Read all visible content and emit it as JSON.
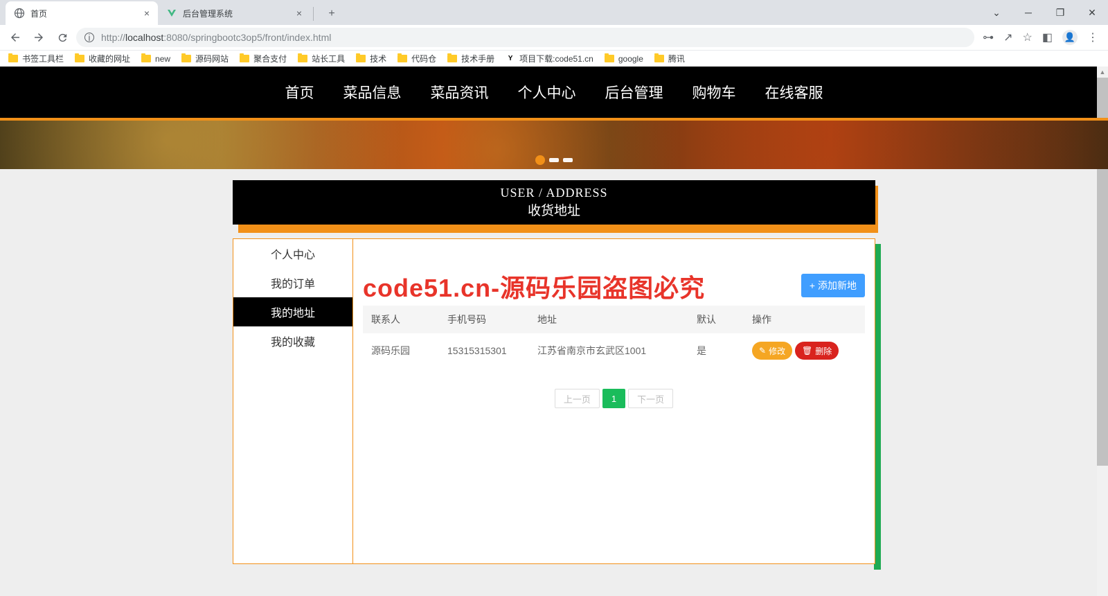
{
  "browser": {
    "tabs": [
      {
        "title": "首页",
        "favicon": "globe",
        "active": true
      },
      {
        "title": "后台管理系统",
        "favicon": "vue",
        "active": false
      }
    ],
    "url_prefix": "http://",
    "url_host": "localhost",
    "url_rest": ":8080/springbootc3op5/front/index.html",
    "bookmarks": [
      {
        "label": "书签工具栏",
        "icon": "folder"
      },
      {
        "label": "收藏的网址",
        "icon": "folder"
      },
      {
        "label": "new",
        "icon": "folder"
      },
      {
        "label": "源码网站",
        "icon": "folder"
      },
      {
        "label": "聚合支付",
        "icon": "folder"
      },
      {
        "label": "站长工具",
        "icon": "folder"
      },
      {
        "label": "技术",
        "icon": "folder"
      },
      {
        "label": "代码仓",
        "icon": "folder"
      },
      {
        "label": "技术手册",
        "icon": "folder"
      },
      {
        "label": "项目下载:code51.cn",
        "icon": "y"
      },
      {
        "label": "google",
        "icon": "folder"
      },
      {
        "label": "腾讯",
        "icon": "folder"
      }
    ]
  },
  "nav": {
    "items": [
      "首页",
      "菜品信息",
      "菜品资讯",
      "个人中心",
      "后台管理",
      "购物车",
      "在线客服"
    ]
  },
  "title": {
    "en": "USER / ADDRESS",
    "zh": "收货地址"
  },
  "sidebar": {
    "items": [
      {
        "label": "个人中心",
        "active": false
      },
      {
        "label": "我的订单",
        "active": false
      },
      {
        "label": "我的地址",
        "active": true
      },
      {
        "label": "我的收藏",
        "active": false
      }
    ]
  },
  "watermark": "code51.cn-源码乐园盗图必究",
  "buttons": {
    "add": "添加新地",
    "edit": "修改",
    "delete": "删除"
  },
  "table": {
    "headers": [
      "联系人",
      "手机号码",
      "地址",
      "默认",
      "操作"
    ],
    "rows": [
      {
        "contact": "源码乐园",
        "phone": "15315315301",
        "address": "江苏省南京市玄武区1001",
        "default": "是"
      }
    ]
  },
  "pagination": {
    "prev": "上一页",
    "current": "1",
    "next": "下一页"
  }
}
